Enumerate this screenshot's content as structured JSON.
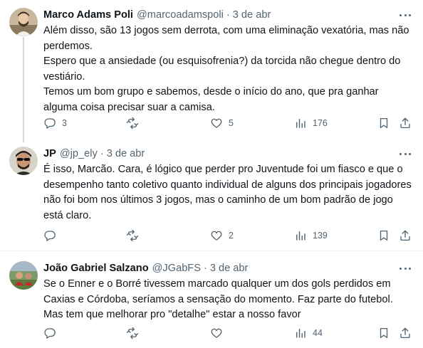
{
  "colors": {
    "text": "#0f1419",
    "muted": "#536471",
    "line": "#cfd9de",
    "border": "#eff3f4"
  },
  "tweets": [
    {
      "name": "Marco Adams Poli",
      "handle": "@marcoadamspoli",
      "separator": "·",
      "date": "3 de abr",
      "text": [
        "Além disso, são 13 jogos sem derrota, com uma eliminação vexatória, mas não perdemos.",
        "Espero que a ansiedade (ou esquisofrenia?) da torcida não chegue dentro do vestiário.",
        "Temos um bom grupo e sabemos, desde o início do ano, que pra ganhar alguma coisa precisar suar a camisa."
      ],
      "replies": "3",
      "retweets": "",
      "likes": "5",
      "views": "176"
    },
    {
      "name": "JP",
      "handle": "@jp_ely",
      "separator": "·",
      "date": "3 de abr",
      "text": [
        "É isso, Marcão. Cara, é lógico que perder pro Juventude foi um fiasco e que o desempenho tanto coletivo quanto individual de alguns dos principais jogadores não foi bom nos últimos 3 jogos, mas o caminho de um bom padrão de jogo está claro."
      ],
      "replies": "",
      "retweets": "",
      "likes": "2",
      "views": "139"
    },
    {
      "name": "João Gabriel Salzano",
      "handle": "@JGabFS",
      "separator": "·",
      "date": "3 de abr",
      "text": [
        "Se o Enner e o Borré tivessem marcado qualquer um dos gols perdidos em Caxias e Córdoba, seríamos a sensação do momento. Faz parte do futebol. Mas tem que melhorar pro \"detalhe\" estar a nosso favor"
      ],
      "replies": "",
      "retweets": "",
      "likes": "",
      "views": "44"
    }
  ]
}
